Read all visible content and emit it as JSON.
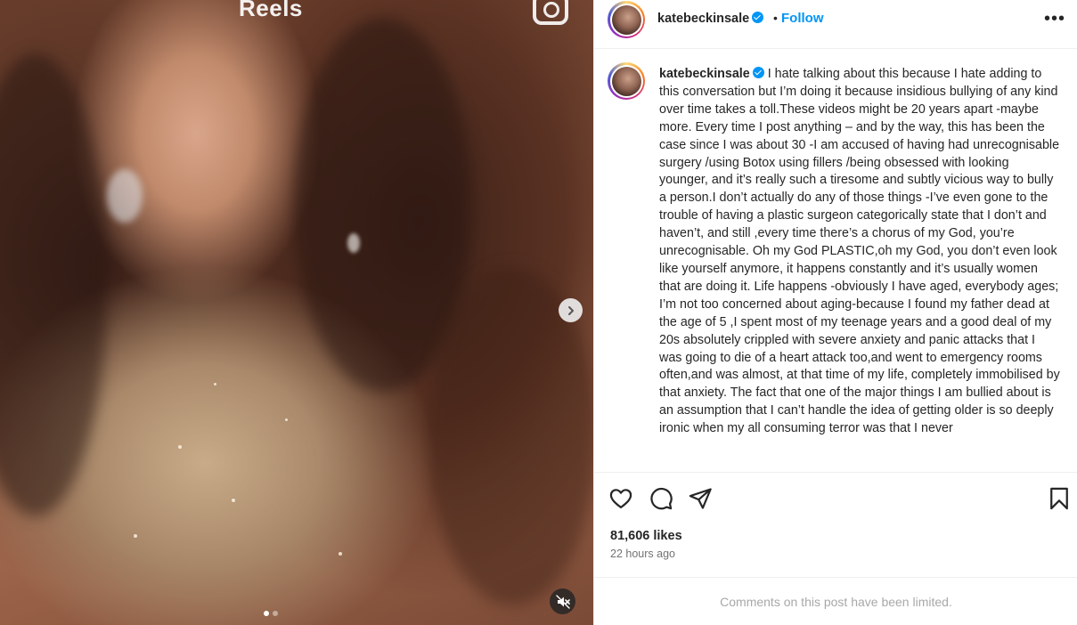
{
  "media": {
    "overlay_title": "Reels",
    "logo_icon": "instagram-logo-icon",
    "next_icon": "chevron-right-icon",
    "mute_icon": "speaker-muted-icon",
    "carousel_total": 2,
    "carousel_active": 1
  },
  "header": {
    "username": "katebeckinsale",
    "separator": "•",
    "follow_label": "Follow",
    "more_label": "•••"
  },
  "caption": {
    "username": "katebeckinsale",
    "text": "I hate talking about this because I hate adding to this conversation but I’m doing it because insidious bullying of any kind over time takes a toll.These videos might be 20 years apart -maybe more. Every time I post anything – and by the way, this has been the case since I was about 30 -I am accused of having had unrecognisable surgery /using Botox using fillers /being obsessed with looking younger, and it’s really such a tiresome and subtly vicious way to bully a person.I don’t actually do any of those things -I’ve even gone to the trouble of having a plastic surgeon categorically state that I don’t and haven’t, and still ,every time there’s a chorus of my God, you’re unrecognisable. Oh my God PLASTIC,oh my God, you don’t even look like yourself anymore, it happens constantly and it’s usually women that are doing it. Life happens -obviously I have aged, everybody ages; I’m not too concerned about aging-because I found my father dead at the age of 5 ,I spent most of my teenage years and a good deal of my 20s absolutely crippled with severe anxiety and panic attacks that I was going to die of a heart attack too,and went to emergency rooms often,and was almost, at that time of my life, completely immobilised by that anxiety. The fact that one of the major things I am bullied about is an assumption that I can’t handle the idea of getting older is so deeply ironic when my all consuming terror was that I never"
  },
  "actions": {
    "like_icon": "heart-icon",
    "comment_icon": "comment-icon",
    "share_icon": "share-icon",
    "save_icon": "bookmark-icon"
  },
  "stats": {
    "likes": "81,606 likes",
    "time_ago": "22 hours ago"
  },
  "comments": {
    "limited_text": "Comments on this post have been limited."
  },
  "colors": {
    "accent": "#0095f6",
    "text": "#262626",
    "muted": "#737373"
  }
}
